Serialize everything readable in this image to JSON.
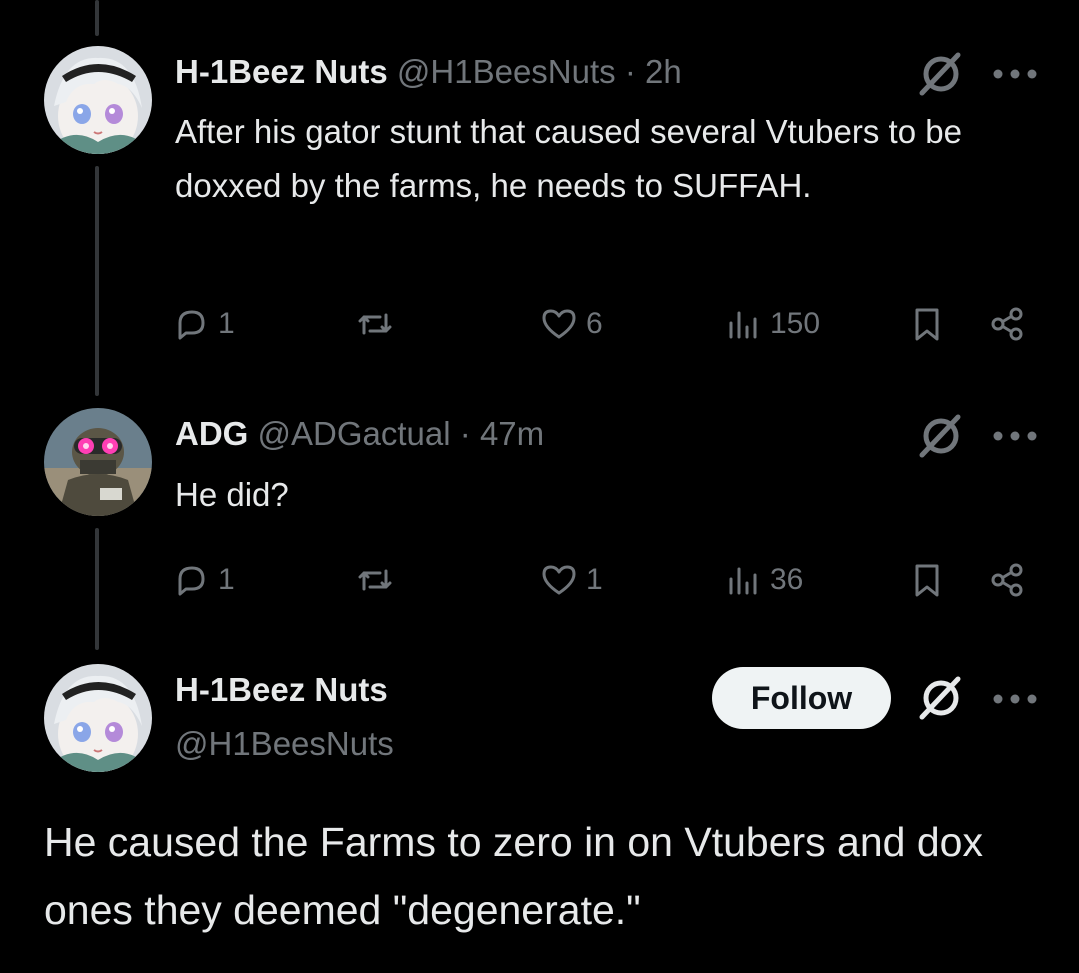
{
  "tweets": [
    {
      "name": "H-1Beez Nuts",
      "handle": "@H1BeesNuts",
      "sep": "·",
      "time": "2h",
      "text": "After his gator stunt that caused several Vtubers to be doxxed by the farms, he needs to SUFFAH.",
      "replies": "1",
      "retweets": "",
      "likes": "6",
      "views": "150"
    },
    {
      "name": "ADG",
      "handle": "@ADGactual",
      "sep": "·",
      "time": "47m",
      "text": "He did?",
      "replies": "1",
      "retweets": "",
      "likes": "1",
      "views": "36"
    }
  ],
  "main": {
    "name": "H-1Beez Nuts",
    "handle": "@H1BeesNuts",
    "follow_label": "Follow",
    "text": "He caused the Farms to zero in on Vtubers and dox ones they deemed \"degenerate.\""
  },
  "icons": {
    "reply": "reply-icon",
    "retweet": "retweet-icon",
    "like": "heart-icon",
    "views": "views-icon",
    "bookmark": "bookmark-icon",
    "share": "share-icon",
    "grok": "grok-icon",
    "more": "more-icon"
  },
  "colors": {
    "background": "#000000",
    "text": "#e7e9ea",
    "muted": "#71767b",
    "thread_line": "#333639",
    "follow_bg": "#eff3f4"
  }
}
